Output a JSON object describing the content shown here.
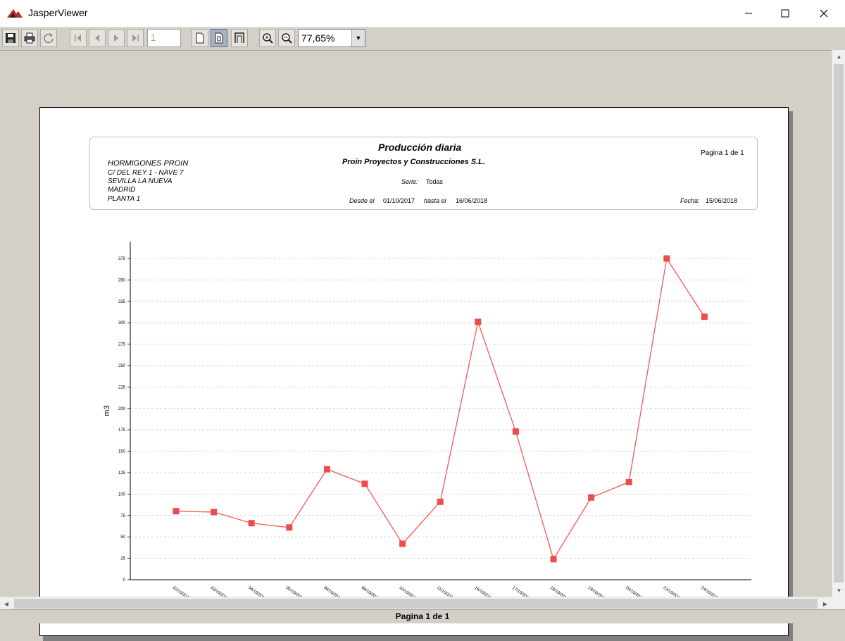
{
  "window": {
    "title": "JasperViewer"
  },
  "toolbar": {
    "page_number": "1",
    "zoom": "77,65%"
  },
  "report": {
    "title": "Producción diaria",
    "subtitle": "Proin Proyectos y Construcciones S.L.",
    "company": [
      "HORMIGONES PROIN",
      "C/ DEL REY 1 - NAVE 7",
      "SEVILLA LA NUEVA",
      "MADRID",
      "PLANTA 1"
    ],
    "page_info": "Pagina 1 de 1",
    "serie_label": "Serie:",
    "serie_value": "Todas",
    "desde_label": "Desde el",
    "desde_value": "01/10/2017",
    "hasta_label": "hasta el",
    "hasta_value": "16/06/2018",
    "fecha_label": "Fecha:",
    "fecha_value": "15/06/2018"
  },
  "status": {
    "text": "Pagina 1 de 1"
  },
  "colors": {
    "series": "#f26262",
    "marker": "#ee4b4b"
  },
  "chart_data": {
    "type": "line",
    "ylabel": "m3",
    "xlabel": "",
    "ylim": [
      0,
      375
    ],
    "yticks": [
      0,
      25,
      50,
      75,
      100,
      125,
      150,
      175,
      200,
      225,
      250,
      275,
      300,
      325,
      350,
      375
    ],
    "grid": true,
    "categories": [
      "02/10/2017",
      "03/10/2017",
      "04/10/2017",
      "05/10/2017",
      "06/10/2017",
      "09/10/2017",
      "10/10/2017",
      "11/10/2017",
      "16/10/2017",
      "17/10/2017",
      "18/10/2017",
      "19/10/2017",
      "20/10/2017",
      "23/10/2017",
      "24/10/2017"
    ],
    "series": [
      {
        "values": [
          80,
          79,
          66,
          61,
          129,
          112,
          42,
          91,
          301,
          173,
          24,
          96,
          114,
          375,
          307
        ]
      }
    ]
  }
}
